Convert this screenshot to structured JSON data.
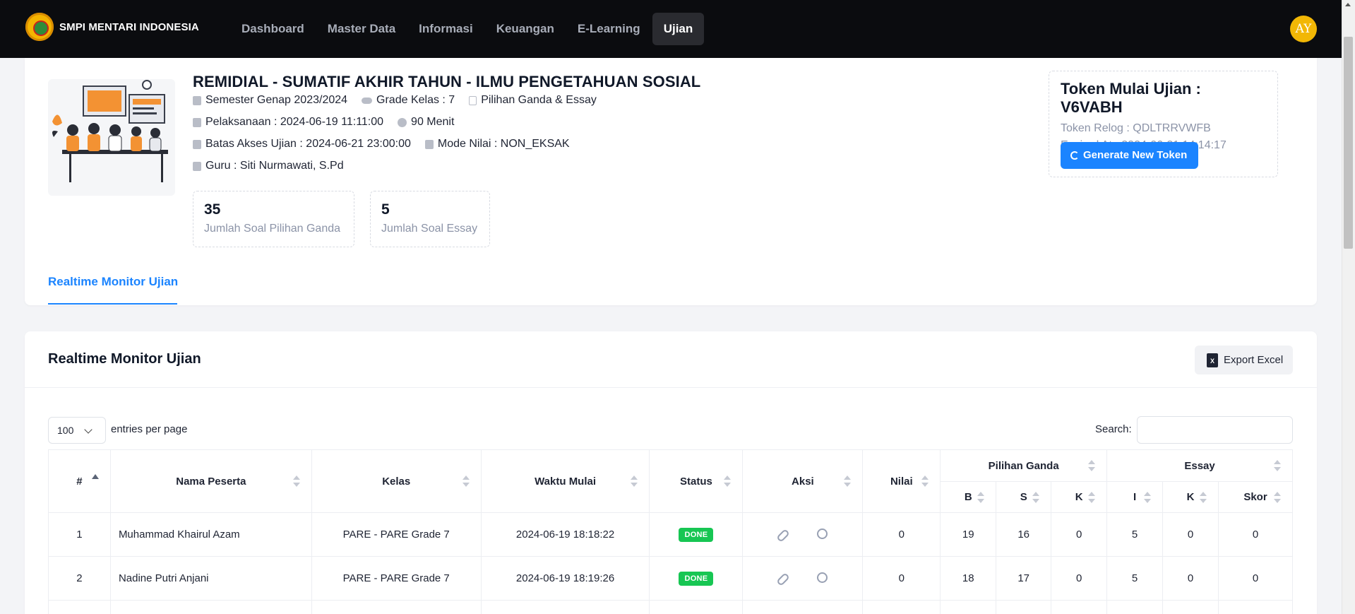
{
  "brand": {
    "name": "SMPI MENTARI INDONESIA"
  },
  "nav": [
    {
      "label": "Dashboard"
    },
    {
      "label": "Master Data"
    },
    {
      "label": "Informasi"
    },
    {
      "label": "Keuangan"
    },
    {
      "label": "E-Learning"
    },
    {
      "label": "Ujian",
      "active": true
    }
  ],
  "user": {
    "initials": "AY",
    "avatar_color": "#f2b705"
  },
  "exam": {
    "title": "REMIDIAL - SUMATIF AKHIR TAHUN - ILMU PENGETAHUAN SOSIAL",
    "semester": "Semester Genap 2023/2024",
    "grade": "Grade Kelas : 7",
    "type": "Pilihan Ganda & Essay",
    "schedule": "Pelaksanaan : 2024-06-19 11:11:00",
    "duration": "90 Menit",
    "deadline": "Batas Akses Ujian : 2024-06-21 23:00:00",
    "score_mode": "Mode Nilai : NON_EKSAK",
    "teacher": "Guru : Siti Nurmawati, S.Pd"
  },
  "stats": [
    {
      "value": "35",
      "label": "Jumlah Soal Pilihan Ganda"
    },
    {
      "value": "5",
      "label": "Jumlah Soal Essay"
    }
  ],
  "token": {
    "main": "Token Mulai Ujian : V6VABH",
    "relog": "Token Relog : QDLTRRVWFB",
    "expired": "Expired At : 2024-06-21 14:14:17",
    "button_label": "Generate New Token",
    "button_color": "#1b84ff"
  },
  "tab": {
    "label": "Realtime Monitor Ujian"
  },
  "monitor": {
    "title": "Realtime Monitor Ujian",
    "export_label": "Export Excel",
    "page_length": "100",
    "page_length_label": "entries per page",
    "search_label": "Search:",
    "search_value": "",
    "columns": {
      "no": "#",
      "name": "Nama Peserta",
      "kelas": "Kelas",
      "start": "Waktu Mulai",
      "status": "Status",
      "aksi": "Aksi",
      "nilai": "Nilai",
      "pg": "Pilihan Ganda",
      "essay": "Essay",
      "pg_b": "B",
      "pg_s": "S",
      "pg_k": "K",
      "es_i": "I",
      "es_k": "K",
      "es_skor": "Skor"
    },
    "rows": [
      {
        "no": "1",
        "name": "Muhammad Khairul Azam",
        "kelas": "PARE - PARE Grade 7",
        "start": "2024-06-19 18:18:22",
        "status": "DONE",
        "nilai": "0",
        "pg_b": "19",
        "pg_s": "16",
        "pg_k": "0",
        "es_i": "5",
        "es_k": "0",
        "es_skor": "0"
      },
      {
        "no": "2",
        "name": "Nadine Putri Anjani",
        "kelas": "PARE - PARE Grade 7",
        "start": "2024-06-19 18:19:26",
        "status": "DONE",
        "nilai": "0",
        "pg_b": "18",
        "pg_s": "17",
        "pg_k": "0",
        "es_i": "5",
        "es_k": "0",
        "es_skor": "0"
      }
    ],
    "status_color": "#17c653"
  }
}
